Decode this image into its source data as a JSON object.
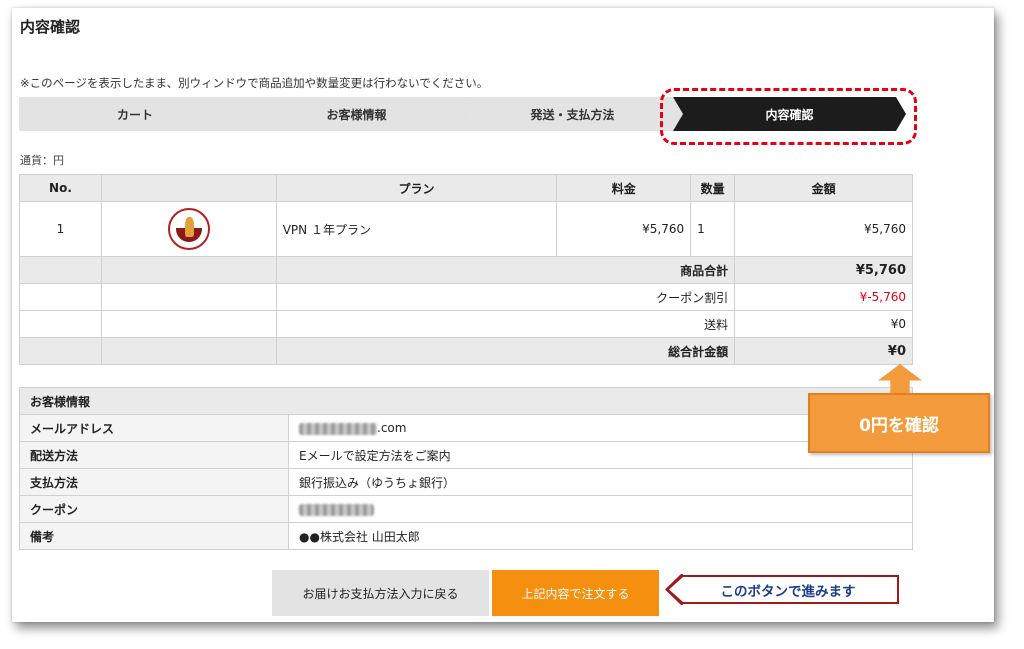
{
  "page": {
    "title": "内容確認",
    "notice": "※このページを表示したまま、別ウィンドウで商品追加や数量変更は行わないでください。",
    "currency_label": "通貨：円"
  },
  "steps": [
    {
      "label": "カート",
      "active": false
    },
    {
      "label": "お客様情報",
      "active": false
    },
    {
      "label": "発送・支払方法",
      "active": false
    },
    {
      "label": "内容確認",
      "active": true
    }
  ],
  "order_table": {
    "headers": [
      "No.",
      "",
      "プラン",
      "料金",
      "数量",
      "金額"
    ],
    "items": [
      {
        "no": "1",
        "image": "vpn-seal-logo",
        "plan": "VPN １年プラン",
        "price": "¥5,760",
        "qty": "1",
        "amount": "¥5,760"
      }
    ],
    "summary": {
      "subtotal_label": "商品合計",
      "subtotal_value": "¥5,760",
      "coupon_label": "クーポン割引",
      "coupon_value": "¥-5,760",
      "shipping_label": "送料",
      "shipping_value": "¥0",
      "total_label": "総合計金額",
      "total_value": "¥0"
    }
  },
  "customer": {
    "heading": "お客様情報",
    "email_label": "メールアドレス",
    "email_suffix": ".com",
    "delivery_label": "配送方法",
    "delivery_value": "Eメールで設定方法をご案内",
    "payment_label": "支払方法",
    "payment_value": "銀行振込み（ゆうちょ銀行）",
    "coupon_label": "クーポン",
    "note_label": "備考",
    "note_value": "●●株式会社 山田太郎"
  },
  "buttons": {
    "back": "お届けお支払方法入力に戻る",
    "order": "上記内容で注文する"
  },
  "annotations": {
    "zero_yen": "0円を確認",
    "proceed": "このボタンで進みます"
  },
  "colors": {
    "accent_orange": "#f48f10",
    "callout_orange": "#f39a3c",
    "highlight_red": "#e60012",
    "active_step": "#1c1c1c"
  }
}
